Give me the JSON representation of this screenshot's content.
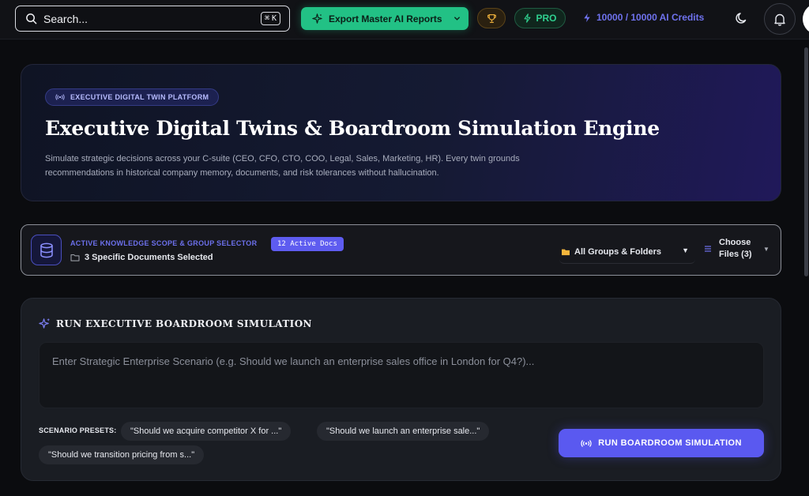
{
  "topbar": {
    "search_placeholder": "Search...",
    "search_shortcut_symbol": "⌘",
    "search_shortcut_key": "K",
    "export_label": "Export Master AI Reports",
    "pro_label": "PRO",
    "credits": "10000 / 10000 AI Credits"
  },
  "hero": {
    "badge": "EXECUTIVE DIGITAL TWIN PLATFORM",
    "title": "Executive Digital Twins & Boardroom Simulation Engine",
    "description": "Simulate strategic decisions across your C-suite (CEO, CFO, CTO, COO, Legal, Sales, Marketing, HR). Every twin grounds recommendations in historical company memory, documents, and risk tolerances without hallucination."
  },
  "scope": {
    "label": "ACTIVE KNOWLEDGE SCOPE & GROUP SELECTOR",
    "docs_badge": "12 Active Docs",
    "selected": "3 Specific Documents Selected",
    "groups_select": "All Groups & Folders",
    "files_line1": "Choose",
    "files_line2": "Files (3)"
  },
  "simulation": {
    "title": "RUN EXECUTIVE BOARDROOM SIMULATION",
    "scenario_placeholder": "Enter Strategic Enterprise Scenario (e.g. Should we launch an enterprise sales office in London for Q4?)...",
    "presets_label": "SCENARIO PRESETS:",
    "presets": [
      "\"Should we acquire competitor X for ...\"",
      "\"Should we launch an enterprise sale...\"",
      "\"Should we transition pricing from s...\""
    ],
    "run_label": "RUN BOARDROOM SIMULATION"
  },
  "colors": {
    "accent_green": "#22c185",
    "accent_indigo": "#5a59f0",
    "background": "#0b0c0f"
  },
  "icons": [
    "search-icon",
    "sparkle-icon",
    "chevron-down-icon",
    "trophy-icon",
    "bolt-icon",
    "moon-icon",
    "bell-icon",
    "broadcast-icon",
    "database-icon",
    "folder-icon",
    "filter-lines-icon"
  ]
}
